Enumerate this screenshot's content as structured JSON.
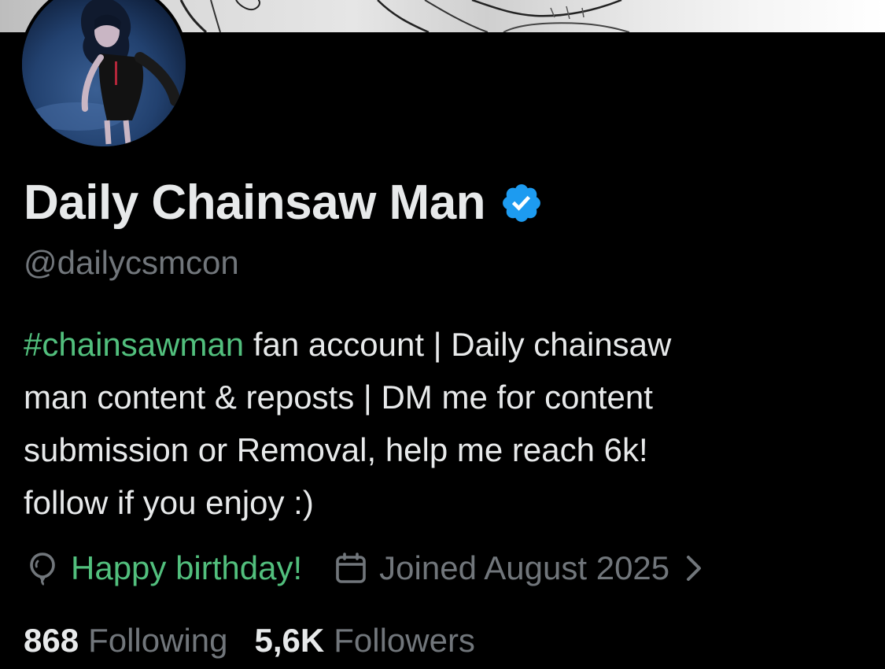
{
  "profile": {
    "display_name": "Daily Chainsaw Man",
    "handle": "@dailycsmcon",
    "verified": true,
    "bio": {
      "hashtag": "#chainsawman",
      "text_line1": " fan account | Daily chainsaw",
      "text_line2": "man content & reposts | DM me for content",
      "text_line3": "submission or Removal, help me reach 6k!",
      "text_line4": "follow if you enjoy :)"
    },
    "meta": {
      "birthday_label": "Happy birthday!",
      "joined_label": "Joined August 2025"
    },
    "stats": {
      "following_count": "868",
      "following_label": "Following",
      "followers_count": "5,6K",
      "followers_label": "Followers"
    }
  },
  "colors": {
    "background": "#000000",
    "primary_text": "#e7e9ea",
    "secondary_text": "#71767b",
    "accent_green": "#52bf7d",
    "verified_blue": "#1d9bf0"
  },
  "icons": {
    "verified": "verified-badge-icon",
    "birthday": "balloon-icon",
    "joined": "calendar-icon",
    "chevron": "chevron-right-icon"
  }
}
